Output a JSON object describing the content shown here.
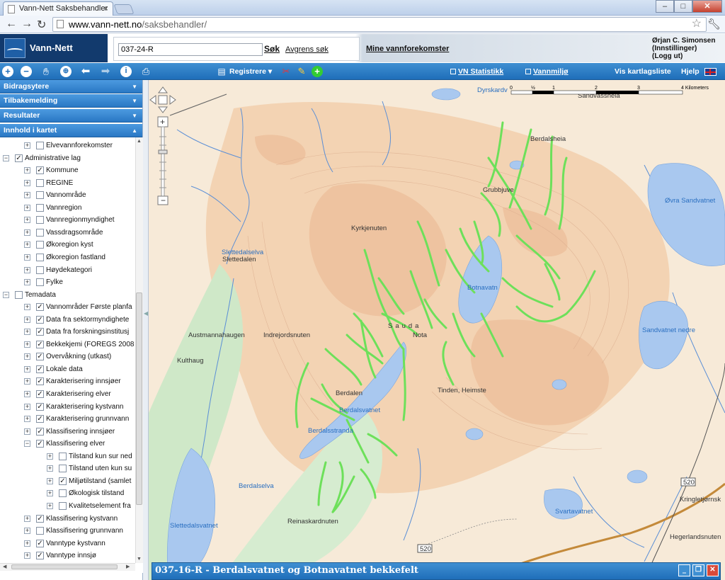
{
  "browser": {
    "tab_title": "Vann-Nett Saksbehandler",
    "url_host": "www.vann-nett.no",
    "url_path": "/saksbehandler/"
  },
  "header": {
    "logo_text": "Vann-Nett",
    "search_value": "037-24-R",
    "search_button": "Søk",
    "refine_link": "Avgrens søk",
    "my_waters_link": "Mine vannforekomster",
    "user_name": "Ørjan C. Simonsen",
    "settings_link": "(Innstillinger)",
    "logout_link": "(Logg ut)"
  },
  "toolbar": {
    "register_label": "Registrere",
    "vn_stats": "VN Statistikk",
    "vannmiljo": "Vannmiljø",
    "layer_list": "Vis kartlagsliste",
    "help": "Hjelp"
  },
  "sidebar": {
    "panels": [
      "Bidragsytere",
      "Tilbakemelding",
      "Resultater",
      "Innhold i kartet"
    ]
  },
  "tree": [
    {
      "label": "Elvevannforekomster",
      "level": 1,
      "expander": "+",
      "checked": false
    },
    {
      "label": "Administrative lag",
      "level": 0,
      "expander": "−",
      "checked": true
    },
    {
      "label": "Kommune",
      "level": 1,
      "expander": "+",
      "checked": true
    },
    {
      "label": "REGINE",
      "level": 1,
      "expander": "+",
      "checked": false
    },
    {
      "label": "Vannområde",
      "level": 1,
      "expander": "+",
      "checked": false
    },
    {
      "label": "Vannregion",
      "level": 1,
      "expander": "+",
      "checked": false
    },
    {
      "label": "Vannregionmyndighet",
      "level": 1,
      "expander": "+",
      "checked": false
    },
    {
      "label": "Vassdragsområde",
      "level": 1,
      "expander": "+",
      "checked": false
    },
    {
      "label": "Økoregion kyst",
      "level": 1,
      "expander": "+",
      "checked": false
    },
    {
      "label": "Økoregion fastland",
      "level": 1,
      "expander": "+",
      "checked": false
    },
    {
      "label": "Høydekategori",
      "level": 1,
      "expander": "+",
      "checked": false
    },
    {
      "label": "Fylke",
      "level": 1,
      "expander": "+",
      "checked": false
    },
    {
      "label": "Temadata",
      "level": 0,
      "expander": "−",
      "checked": false
    },
    {
      "label": "Vannområder Første planfa",
      "level": 1,
      "expander": "+",
      "checked": true
    },
    {
      "label": "Data fra sektormyndighete",
      "level": 1,
      "expander": "+",
      "checked": true
    },
    {
      "label": "Data fra forskningsinstitusj",
      "level": 1,
      "expander": "+",
      "checked": true
    },
    {
      "label": "Bekkekjemi (FOREGS 2008",
      "level": 1,
      "expander": "+",
      "checked": true
    },
    {
      "label": "Overvåkning (utkast)",
      "level": 1,
      "expander": "+",
      "checked": true
    },
    {
      "label": "Lokale data",
      "level": 1,
      "expander": "+",
      "checked": true
    },
    {
      "label": "Karakterisering innsjøer",
      "level": 1,
      "expander": "+",
      "checked": true
    },
    {
      "label": "Karakterisering elver",
      "level": 1,
      "expander": "+",
      "checked": true
    },
    {
      "label": "Karakterisering kystvann",
      "level": 1,
      "expander": "+",
      "checked": true
    },
    {
      "label": "Karakterisering grunnvann",
      "level": 1,
      "expander": "+",
      "checked": true
    },
    {
      "label": "Klassifisering innsjøer",
      "level": 1,
      "expander": "+",
      "checked": true
    },
    {
      "label": "Klassifisering elver",
      "level": 1,
      "expander": "−",
      "checked": true
    },
    {
      "label": "Tilstand kun sur ned",
      "level": 2,
      "expander": "+",
      "checked": false
    },
    {
      "label": "Tilstand uten kun su",
      "level": 2,
      "expander": "+",
      "checked": false
    },
    {
      "label": "Miljøtilstand (samlet",
      "level": 2,
      "expander": "+",
      "checked": true
    },
    {
      "label": "Økologisk tilstand",
      "level": 2,
      "expander": "+",
      "checked": false
    },
    {
      "label": "Kvalitetselement fra",
      "level": 2,
      "expander": "+",
      "checked": false
    },
    {
      "label": "Klassifisering kystvann",
      "level": 1,
      "expander": "+",
      "checked": true
    },
    {
      "label": "Klassifisering grunnvann",
      "level": 1,
      "expander": "+",
      "checked": false
    },
    {
      "label": "Vanntype kystvann",
      "level": 1,
      "expander": "+",
      "checked": true
    },
    {
      "label": "Vanntype innsjø",
      "level": 1,
      "expander": "+",
      "checked": true
    }
  ],
  "map": {
    "scale_unit": "4 Kilometers",
    "scale_ticks": [
      "0",
      "½",
      "1",
      "2",
      "3"
    ],
    "road_number": "520",
    "places": [
      "Dyrskardv",
      "Sandvasshela",
      "Berdalsheia",
      "Grubbjuve",
      "Kyrkjenuten",
      "Slettedalselva",
      "Slettedalen",
      "Botnavatn",
      "Øvra Sandvatnet",
      "Sauda",
      "Nota",
      "Austmannahaugen",
      "Indrejordsnuten",
      "Sandvatnet nedre",
      "Kulthaug",
      "Berdalen",
      "Berdalsvatnet",
      "Berdalsstranda",
      "Tinden, Heimste",
      "Berdalselva",
      "Slettedalsvatnet",
      "Reinaskardnuten",
      "Svartavatnet",
      "Kringletjørnsk",
      "Hegerlandsnuten"
    ]
  },
  "popup": {
    "title": "037-16-R - Berdalsvatnet og Botnavatnet bekkefelt"
  }
}
